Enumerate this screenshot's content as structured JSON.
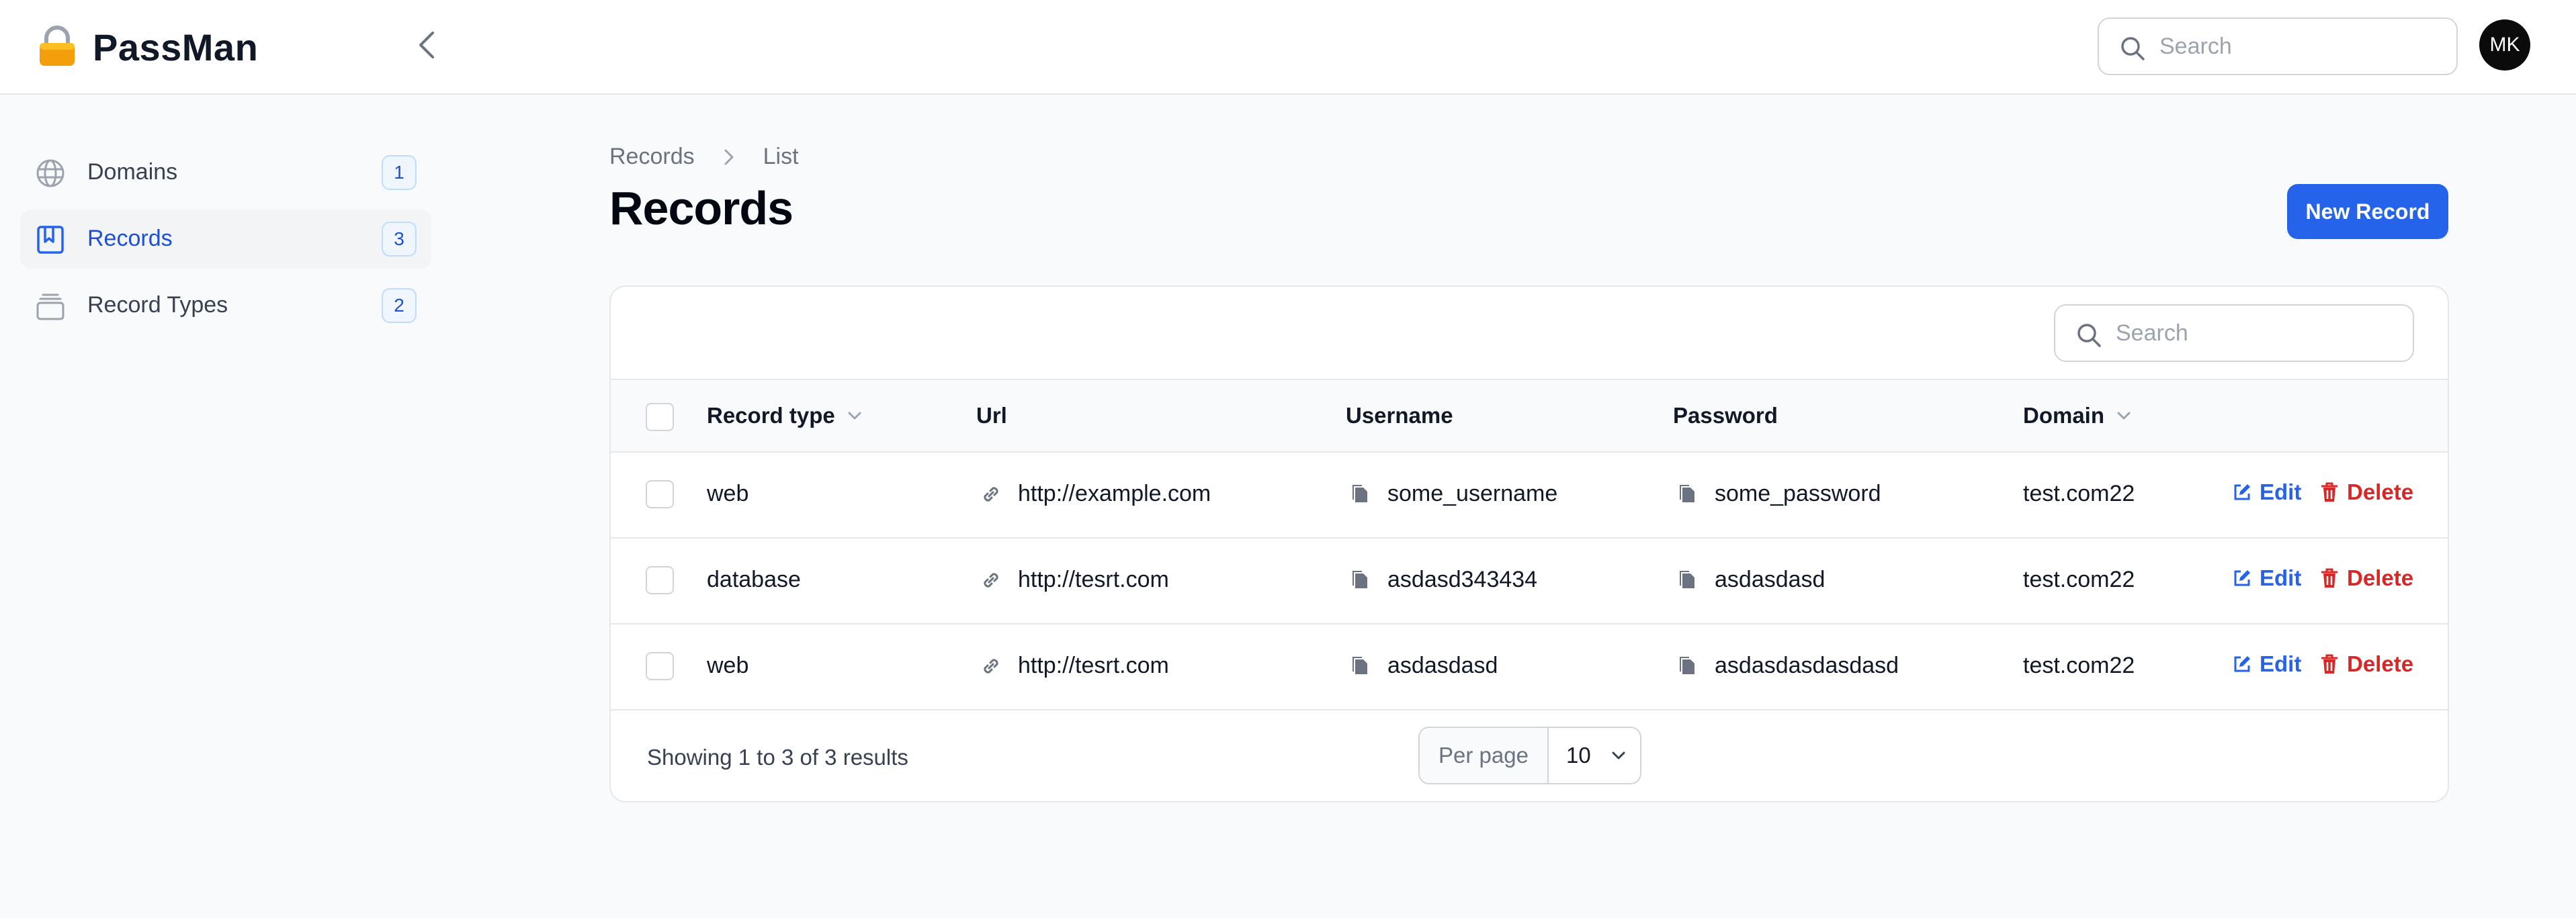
{
  "app": {
    "name": "PassMan"
  },
  "header": {
    "search_placeholder": "Search",
    "user_initials": "MK"
  },
  "sidebar": {
    "items": [
      {
        "label": "Domains",
        "count": "1",
        "icon": "globe-icon",
        "active": false
      },
      {
        "label": "Records",
        "count": "3",
        "icon": "bookmark-icon",
        "active": true
      },
      {
        "label": "Record Types",
        "count": "2",
        "icon": "stack-icon",
        "active": false
      }
    ]
  },
  "breadcrumb": {
    "items": [
      "Records",
      "List"
    ]
  },
  "page": {
    "title": "Records",
    "new_button": "New Record"
  },
  "table": {
    "search_placeholder": "Search",
    "columns": [
      "Record type",
      "Url",
      "Username",
      "Password",
      "Domain"
    ],
    "rows": [
      {
        "record_type": "web",
        "url": "http://example.com",
        "username": "some_username",
        "password": "some_password",
        "domain": "test.com22"
      },
      {
        "record_type": "database",
        "url": "http://tesrt.com",
        "username": "asdasd343434",
        "password": "asdasdasd",
        "domain": "test.com22"
      },
      {
        "record_type": "web",
        "url": "http://tesrt.com",
        "username": "asdasdasd",
        "password": "asdasdasdasdasd",
        "domain": "test.com22"
      }
    ],
    "row_actions": {
      "edit": "Edit",
      "delete": "Delete"
    },
    "footer": {
      "summary": "Showing 1 to 3 of 3 results",
      "per_page_label": "Per page",
      "per_page_value": "10"
    }
  },
  "colors": {
    "accent": "#2563eb",
    "danger": "#dc2626",
    "logo": "#f59e0b"
  }
}
